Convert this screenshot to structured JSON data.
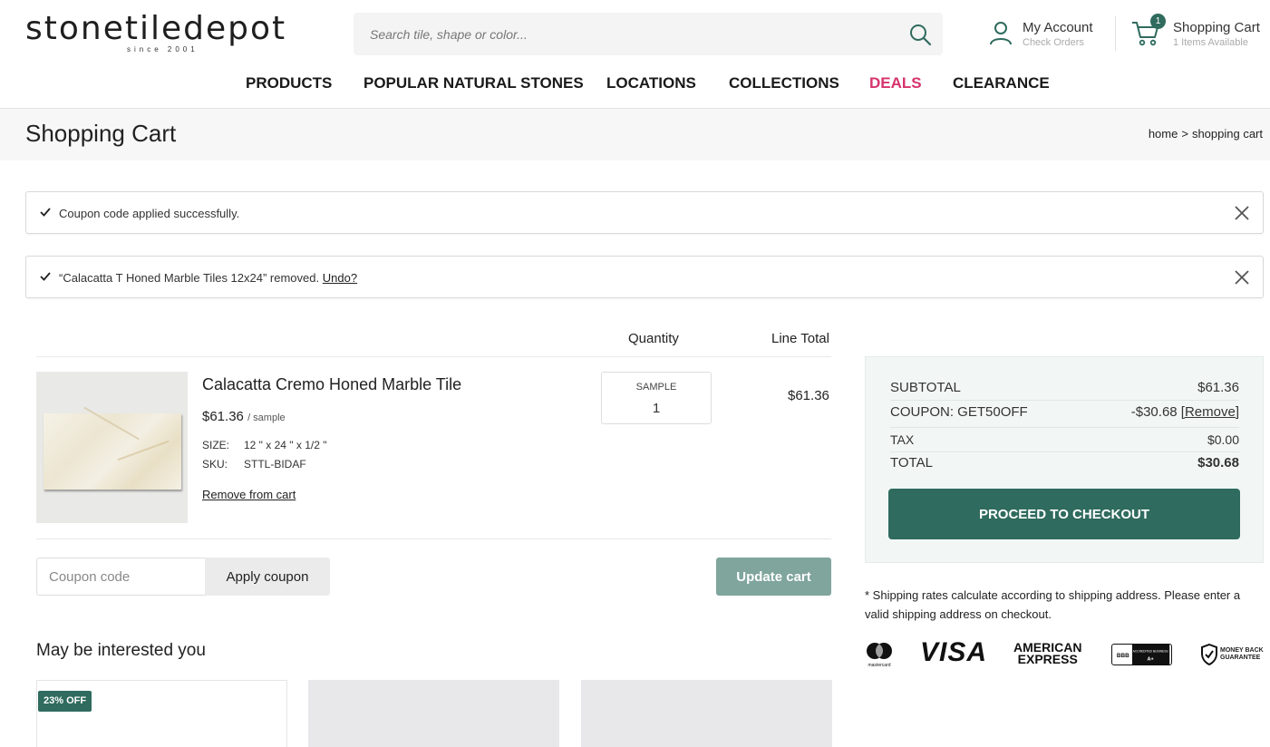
{
  "header": {
    "logo": "stonetiledepot",
    "logo_tagline": "since 2001",
    "search_placeholder": "Search tile, shape or color...",
    "account_title": "My Account",
    "account_sub": "Check Orders",
    "cart_title": "Shopping Cart",
    "cart_sub": "1 Items Available",
    "cart_count": "1"
  },
  "nav": [
    "PRODUCTS",
    "POPULAR NATURAL STONES",
    "LOCATIONS",
    "COLLECTIONS",
    "DEALS",
    "CLEARANCE"
  ],
  "page": {
    "title": "Shopping Cart",
    "breadcrumb": [
      "home",
      ">",
      "shopping cart"
    ]
  },
  "notices": {
    "coupon": "Coupon code applied successfully.",
    "removed": "“Calacatta T Honed Marble Tiles 12x24” removed.",
    "undo": "Undo?"
  },
  "cart": {
    "headers": {
      "quantity": "Quantity",
      "line_total": "Line Total"
    },
    "item": {
      "name": "Calacatta Cremo Honed Marble Tile",
      "price": "$61.36",
      "price_unit": "/ sample",
      "size_label": "SIZE:",
      "size_value": "12 \" x 24 \" x 1/2 \"",
      "sku_label": "SKU:",
      "sku_value": "STTL-BIDAF",
      "remove": "Remove from cart",
      "qty_label": "SAMPLE",
      "qty_value": "1",
      "line_total": "$61.36"
    },
    "coupon_placeholder": "Coupon code",
    "apply_coupon": "Apply coupon",
    "update_cart": "Update cart"
  },
  "related": {
    "title": "May be interested you",
    "badge": "23% OFF"
  },
  "summary": {
    "subtotal_label": "SUBTOTAL",
    "subtotal_value": "$61.36",
    "coupon_label": "COUPON: GET50OFF",
    "coupon_value": "-$30.68",
    "coupon_remove": "[Remove]",
    "tax_label": "TAX",
    "tax_value": "$0.00",
    "total_label": "TOTAL",
    "total_value": "$30.68",
    "checkout": "PROCEED TO CHECKOUT"
  },
  "shipping_note": "* Shipping rates calculate according to shipping address. Please enter a valid shipping address on checkout.",
  "payments": {
    "mastercard": "mastercard",
    "visa": "VISA",
    "amex_line1": "AMERICAN",
    "amex_line2": "EXPRESS",
    "bbb": "BBB",
    "bbb_rating": "A+",
    "bbb_text": "ACCREDITED BUSINESS",
    "guarantee_line1": "MONEY BACK",
    "guarantee_line2": "GUARANTEE"
  },
  "colors": {
    "brand_green": "#2f6b5e",
    "update_green": "#7fa59c",
    "deals_pink": "#d6336c",
    "summary_bg": "#f2f7f6"
  }
}
